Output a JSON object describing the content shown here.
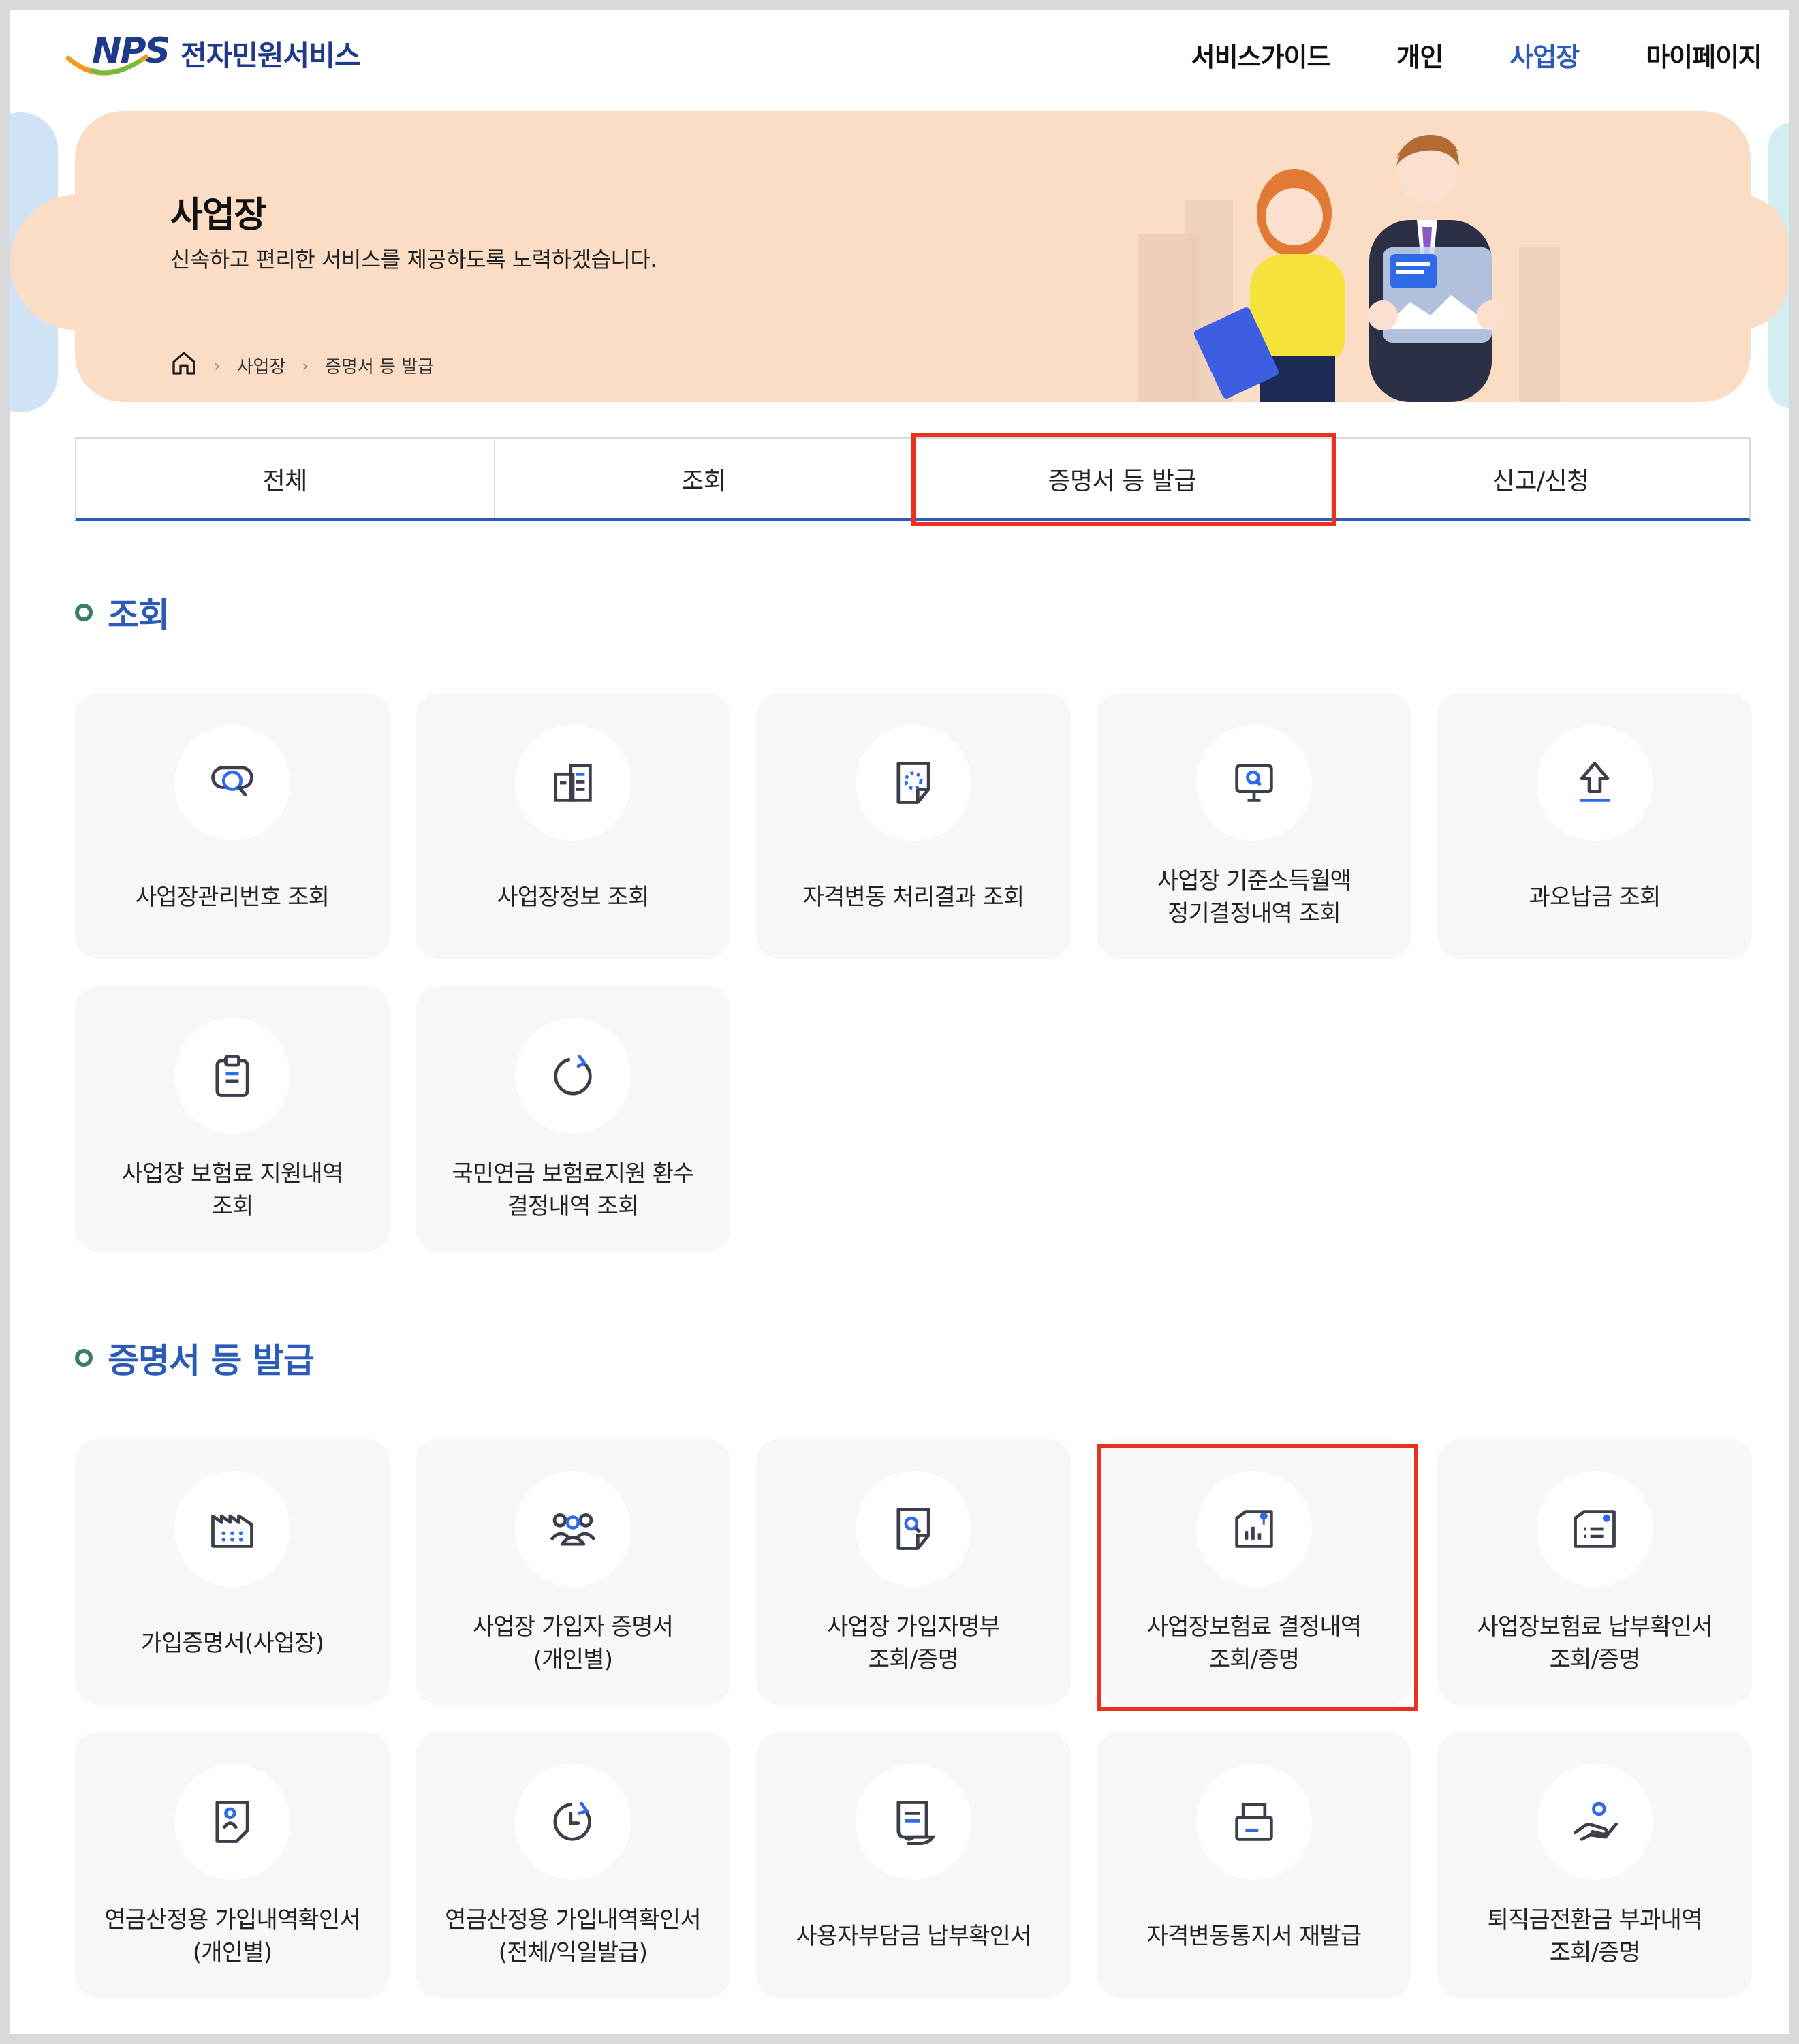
{
  "header": {
    "logo_mark": "NPS",
    "logo_text": "전자민원서비스",
    "nav": [
      {
        "label": "서비스가이드",
        "active": false
      },
      {
        "label": "개인",
        "active": false
      },
      {
        "label": "사업장",
        "active": true
      },
      {
        "label": "마이페이지",
        "active": false
      }
    ]
  },
  "hero": {
    "title": "사업장",
    "subtitle": "신속하고 편리한 서비스를 제공하도록 노력하겠습니다.",
    "breadcrumb": [
      "사업장",
      "증명서 등 발급"
    ]
  },
  "tabs": [
    {
      "label": "전체"
    },
    {
      "label": "조회"
    },
    {
      "label": "증명서 등 발급",
      "highlighted": true
    },
    {
      "label": "신고/신청"
    }
  ],
  "sections": {
    "inquiry": {
      "title": "조회",
      "cards": [
        {
          "label": "사업장관리번호 조회",
          "icon": "search-card-icon"
        },
        {
          "label": "사업장정보 조회",
          "icon": "building-icon"
        },
        {
          "label": "자격변동 처리결과 조회",
          "icon": "document-loading-icon"
        },
        {
          "label": "사업장 기준소득월액\n정기결정내역 조회",
          "icon": "monitor-search-icon"
        },
        {
          "label": "과오납금 조회",
          "icon": "upload-arrow-icon"
        },
        {
          "label": "사업장 보험료 지원내역\n조회",
          "icon": "clipboard-icon"
        },
        {
          "label": "국민연금 보험료지원 환수\n결정내역 조회",
          "icon": "refresh-icon"
        }
      ]
    },
    "certificates": {
      "title": "증명서 등 발급",
      "cards": [
        {
          "label": "가입증명서(사업장)",
          "icon": "factory-icon"
        },
        {
          "label": "사업장 가입자 증명서\n(개인별)",
          "icon": "group-icon"
        },
        {
          "label": "사업장 가입자명부\n조회/증명",
          "icon": "document-search-icon"
        },
        {
          "label": "사업장보험료 결정내역\n조회/증명",
          "icon": "chart-document-icon",
          "highlighted": true
        },
        {
          "label": "사업장보험료 납부확인서\n조회/증명",
          "icon": "list-document-icon"
        },
        {
          "label": "연금산정용 가입내역확인서\n(개인별)",
          "icon": "person-document-icon"
        },
        {
          "label": "연금산정용 가입내역확인서\n(전체/익일발급)",
          "icon": "clock-refresh-icon"
        },
        {
          "label": "사용자부담금 납부확인서",
          "icon": "receipt-icon"
        },
        {
          "label": "자격변동통지서 재발급",
          "icon": "print-icon"
        },
        {
          "label": "퇴직금전환금 부과내역\n조회/증명",
          "icon": "hand-person-icon"
        }
      ]
    }
  },
  "colors": {
    "accent": "#2a5bb8",
    "hero_bg": "#fbdcc5",
    "highlight_box": "#e8321f",
    "card_bg": "#f6f7f9"
  }
}
